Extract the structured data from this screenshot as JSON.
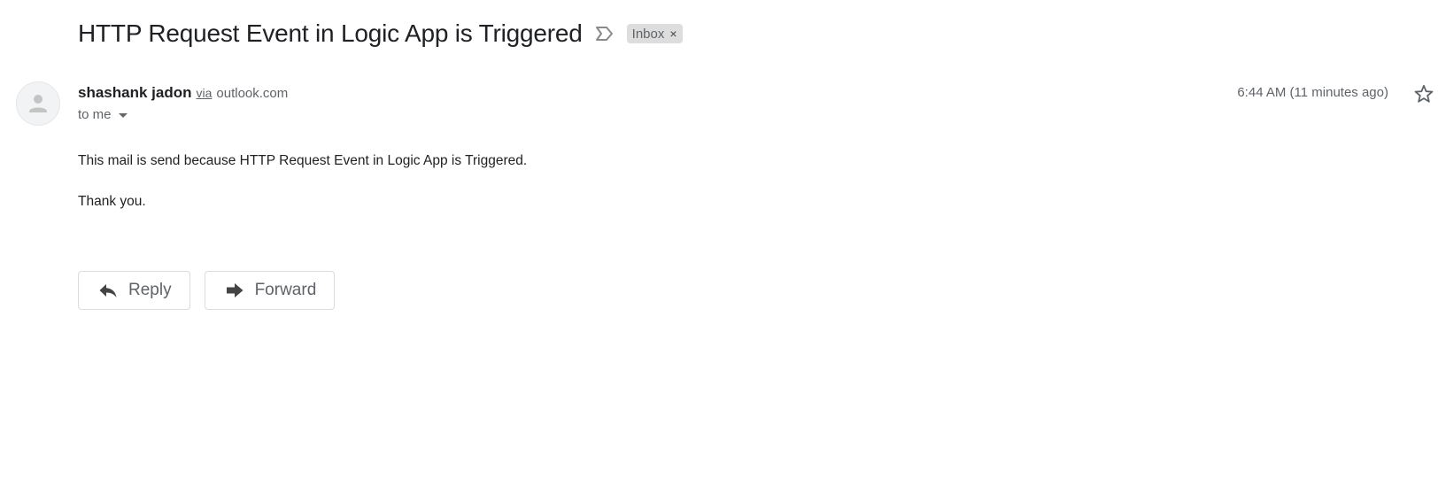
{
  "email": {
    "subject": "HTTP Request Event in Logic App is Triggered",
    "label_chip": "Inbox",
    "label_chip_close": "×",
    "sender": {
      "name": "shashank jadon",
      "via_label": "via",
      "via_domain": "outlook.com"
    },
    "recipient": "to me",
    "timestamp": "6:44 AM (11 minutes ago)",
    "body": {
      "line1": "This mail is send because HTTP Request Event in Logic App is Triggered.",
      "line2": "Thank you."
    }
  },
  "actions": {
    "reply_label": "Reply",
    "forward_label": "Forward"
  },
  "icons": {
    "label": "label-outline-icon",
    "avatar": "person-icon",
    "star": "star-outline-icon",
    "recipient_details": "caret-down-icon",
    "reply": "reply-icon",
    "forward": "forward-icon"
  },
  "colors": {
    "chip_background": "#dddddd",
    "secondary_text": "#5f6368",
    "primary_text": "#202124",
    "button_border": "#dadce0"
  }
}
